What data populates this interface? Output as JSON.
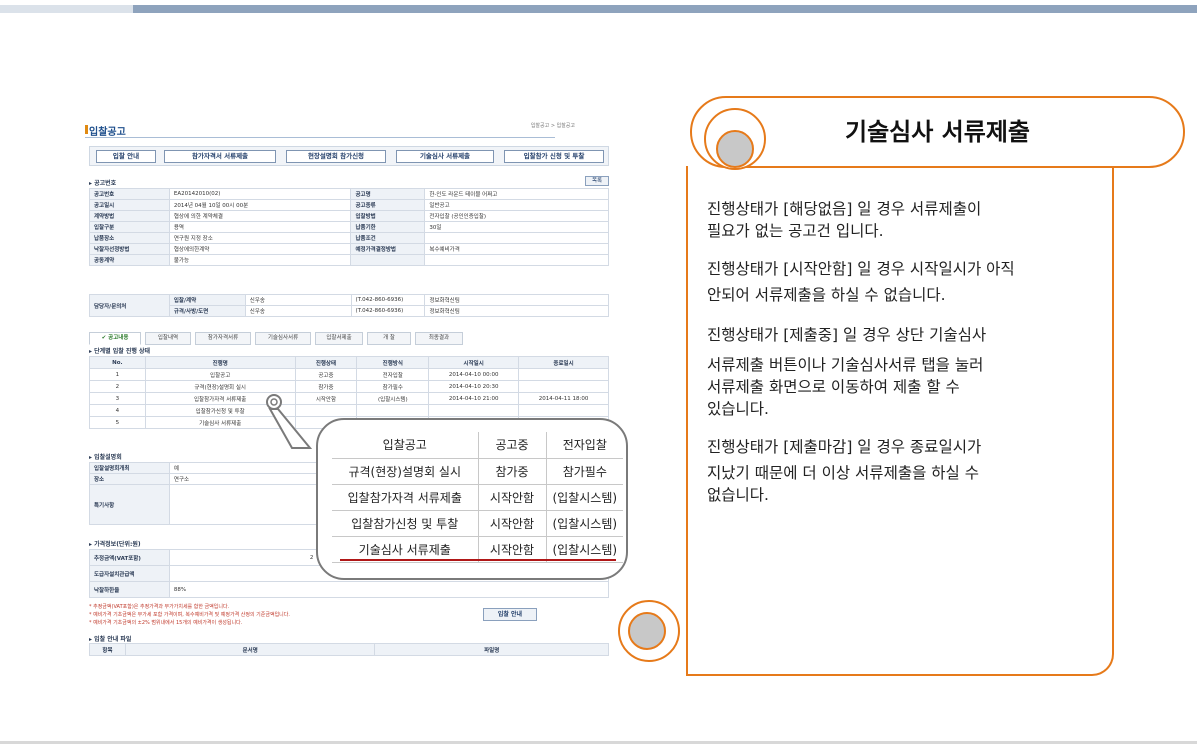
{
  "colors": {
    "accent": "#e67a1a",
    "header_bar": "#8ea3bd",
    "highlight_underline": "#b01717"
  },
  "screenshot": {
    "title": "입찰공고",
    "breadcrumb": "입찰공고 > 입찰공고",
    "nav_buttons": [
      "입찰 안내",
      "참가자격서 서류제출",
      "현장설명회 참가신청",
      "기술심사 서류제출",
      "입찰참가 신청 및 투찰"
    ],
    "notice_section": "공고번호",
    "list_button": "목록",
    "info_rows": [
      {
        "k1": "공고번호",
        "v1": "EA20142010(02)",
        "k2": "공고명",
        "v2": "한-인도 라운드 테이블 어쩌고"
      },
      {
        "k1": "공고일시",
        "v1": "2014년 04월 10일 00시 00분",
        "k2": "공고종류",
        "v2": "일반공고"
      },
      {
        "k1": "계약방법",
        "v1": "협상에 의한 계약체결",
        "k2": "입찰방법",
        "v2": "전자입찰 (공인인증입찰)"
      },
      {
        "k1": "입찰구분",
        "v1": "용역",
        "k2": "납품기한",
        "v2": "30일"
      },
      {
        "k1": "납품장소",
        "v1": "연구원 지정 장소",
        "k2": "납품조건",
        "v2": ""
      },
      {
        "k1": "낙찰자선정방법",
        "v1": "협상에의한계약",
        "k2": "예정가격결정방법",
        "v2": "복수예비가격"
      },
      {
        "k1": "공동계약",
        "v1": "불가능",
        "k2": "",
        "v2": ""
      }
    ],
    "contact": {
      "label": "담당자/문의처",
      "rows": [
        {
          "role": "입찰/계약",
          "name": "신우송",
          "phone": "(T.042-860-6936)",
          "dept": "정보화혁신팀"
        },
        {
          "role": "규격/사방/도면",
          "name": "신우송",
          "phone": "(T.042-860-6936)",
          "dept": "정보화혁신팀"
        }
      ]
    },
    "tabs": [
      "✔ 공고내용",
      "입찰내역",
      "참가자격서류",
      "기술심사서류",
      "입찰서제출",
      "개 찰",
      "최종결과"
    ],
    "stage_section": "단계별 입찰 진행 상태",
    "stage_headers": [
      "No.",
      "진행명",
      "진행상태",
      "진행방식",
      "시작일시",
      "종료일시"
    ],
    "stage_rows": [
      [
        "1",
        "입찰공고",
        "공고중",
        "전자입찰",
        "2014-04-10 00:00",
        ""
      ],
      [
        "2",
        "규격(현장)설명회 실시",
        "참가중",
        "참가필수",
        "2014-04-10 20:30",
        ""
      ],
      [
        "3",
        "입찰참가자격 서류제출",
        "시작안함",
        "(입찰시스템)",
        "2014-04-10 21:00",
        "2014-04-11 18:00"
      ],
      [
        "4",
        "입찰참가신청 및 투찰",
        "",
        "",
        "",
        ""
      ],
      [
        "5",
        "기술심사 서류제출",
        "",
        "",
        "",
        ""
      ]
    ],
    "briefing_section": "입찰설명회",
    "briefing_rows": [
      {
        "k": "입찰설명회개최",
        "v": "예"
      },
      {
        "k": "장소",
        "v": "연구소"
      },
      {
        "k": "특기사항",
        "v": ""
      }
    ],
    "price_section": "가격정보(단위:원)",
    "price_rows": [
      {
        "k": "추정금액(VAT포함)",
        "v": "2"
      },
      {
        "k": "도급자설치관급액",
        "v": ""
      },
      {
        "k": "낙찰하한율",
        "v": "88%"
      }
    ],
    "notes": [
      "* 추정금액(VAT포함)은 추정가격과 부가가치세를 합한 금액입니다.",
      "* 예비가격 기초금액은 부가세 포함 가격이며, 복수예비가격 및 예정가격 산정의 기준금액입니다.",
      "* 예비가격 기초금액의 ±2% 범위내에서 15개의 예비가격이 생성됩니다."
    ],
    "guide_button": "입찰 안내",
    "file_section": "입찰 안내 파일",
    "file_headers": [
      "항목",
      "문서명",
      "파일명"
    ]
  },
  "magnified": [
    [
      "입찰공고",
      "공고중",
      "전자입찰"
    ],
    [
      "규격(현장)설명회 실시",
      "참가중",
      "참가필수"
    ],
    [
      "입찰참가자격 서류제출",
      "시작안함",
      "(입찰시스템)"
    ],
    [
      "입찰참가신청 및 투찰",
      "시작안함",
      "(입찰시스템)"
    ],
    [
      "기술심사 서류제출",
      "시작안함",
      "(입찰시스템)"
    ]
  ],
  "callout": {
    "title": "기술심사 서류제출",
    "paragraphs": [
      [
        "진행상태가 [해당없음] 일 경우 서류제출이",
        "필요가 없는 공고건 입니다."
      ],
      [
        "진행상태가 [시작안함] 일 경우 시작일시가 아직",
        " 안되어 서류제출을 하실 수 없습니다."
      ],
      [
        "진행상태가 [제출중] 일 경우 상단 기술심사",
        "서류제출 버튼이나 기술심사서류 탭을 눌러",
        "서류제출 화면으로 이동하여 제출 할 수",
        "있습니다."
      ],
      [
        "진행상태가 [제출마감] 일 경우 종료일시가",
        "지났기 때문에 더 이상 서류제출을 하실 수",
        "없습니다."
      ]
    ]
  }
}
